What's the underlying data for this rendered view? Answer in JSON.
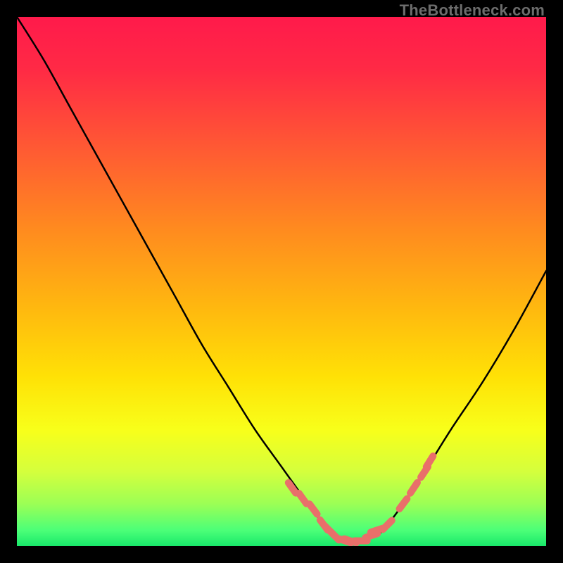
{
  "watermark": "TheBottleneck.com",
  "chart_data": {
    "type": "line",
    "title": "",
    "xlabel": "",
    "ylabel": "",
    "x_range": [
      0,
      100
    ],
    "y_range": [
      0,
      100
    ],
    "series": [
      {
        "name": "bottleneck-curve",
        "x": [
          0,
          5,
          10,
          15,
          20,
          25,
          30,
          35,
          40,
          45,
          50,
          55,
          58,
          60,
          63,
          65,
          68,
          70,
          73,
          77,
          82,
          88,
          94,
          100
        ],
        "y": [
          100,
          92,
          83,
          74,
          65,
          56,
          47,
          38,
          30,
          22,
          15,
          8,
          4,
          2,
          1,
          1,
          2,
          4,
          8,
          14,
          22,
          31,
          41,
          52
        ]
      }
    ],
    "marker_band": {
      "name": "optimal-range-markers",
      "x": [
        52,
        54,
        56,
        58,
        59,
        60,
        62,
        63,
        65,
        67,
        68,
        70,
        73,
        75,
        77,
        78
      ],
      "y": [
        11,
        9,
        7,
        4,
        3,
        2,
        1,
        1,
        1,
        2,
        3,
        4,
        8,
        11,
        14,
        16
      ]
    },
    "gradient_stops": [
      {
        "offset": 0.0,
        "color": "#ff1a4b"
      },
      {
        "offset": 0.1,
        "color": "#ff2a45"
      },
      {
        "offset": 0.25,
        "color": "#ff5a33"
      },
      {
        "offset": 0.4,
        "color": "#ff8a1f"
      },
      {
        "offset": 0.55,
        "color": "#ffb80f"
      },
      {
        "offset": 0.68,
        "color": "#ffe106"
      },
      {
        "offset": 0.78,
        "color": "#f8ff1a"
      },
      {
        "offset": 0.86,
        "color": "#d4ff3d"
      },
      {
        "offset": 0.92,
        "color": "#9cff55"
      },
      {
        "offset": 0.97,
        "color": "#4cff78"
      },
      {
        "offset": 1.0,
        "color": "#18e86a"
      }
    ]
  }
}
